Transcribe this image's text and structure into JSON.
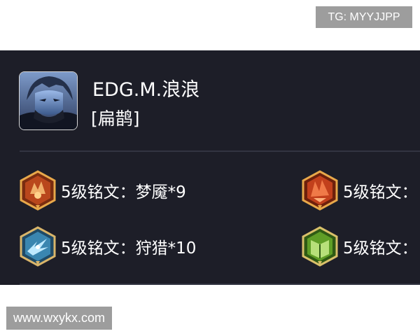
{
  "watermarks": {
    "telegram": "TG: MYYJJPP",
    "site": "www.wxykx.com"
  },
  "player": {
    "name": "EDG.M.浪浪",
    "hero_title": "[扁鹊]",
    "avatar_icon": "hero-portrait-icon"
  },
  "runes": [
    {
      "label": "5级铭文：梦魇*9",
      "icon": "rune-nightmare-icon",
      "color": "#e07a2a"
    },
    {
      "label": "5级铭文：",
      "icon": "rune-red-icon",
      "color": "#d8562c"
    },
    {
      "label": "5级铭文：狩猎*10",
      "icon": "rune-hunt-icon",
      "color": "#4aa6c8"
    },
    {
      "label": "5级铭文：",
      "icon": "rune-green-icon",
      "color": "#7fbf3a"
    }
  ],
  "colors": {
    "panel_background": "#1d1e28",
    "text": "#ffffff",
    "watermark_background": "#9d9d9d"
  }
}
